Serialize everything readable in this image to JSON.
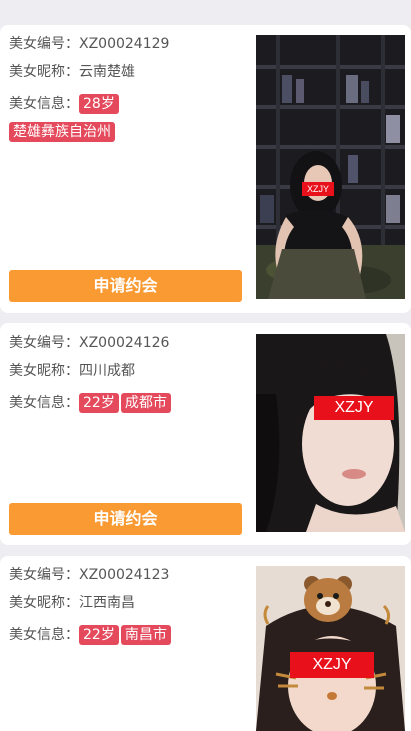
{
  "cards": [
    {
      "id_label": "美女编号：",
      "id_value": "XZ00024129",
      "nick_label": "美女昵称：",
      "nick_value": "云南楚雄",
      "info_label": "美女信息：",
      "age": "28岁",
      "location": "楚雄彝族自治州",
      "button": "申请约会",
      "watermark": "XZJY"
    },
    {
      "id_label": "美女编号：",
      "id_value": "XZ00024126",
      "nick_label": "美女昵称：",
      "nick_value": "四川成都",
      "info_label": "美女信息：",
      "age": "22岁",
      "location": "成都市",
      "button": "申请约会",
      "watermark": "XZJY"
    },
    {
      "id_label": "美女编号：",
      "id_value": "XZ00024123",
      "nick_label": "美女昵称：",
      "nick_value": "江西南昌",
      "info_label": "美女信息：",
      "age": "22岁",
      "location": "南昌市",
      "watermark": "XZJY"
    }
  ],
  "colors": {
    "tag_bg": "#e44a5c",
    "button_bg": "#f99a32",
    "censor": "#e8101a",
    "page_bg": "#eeeef2"
  }
}
